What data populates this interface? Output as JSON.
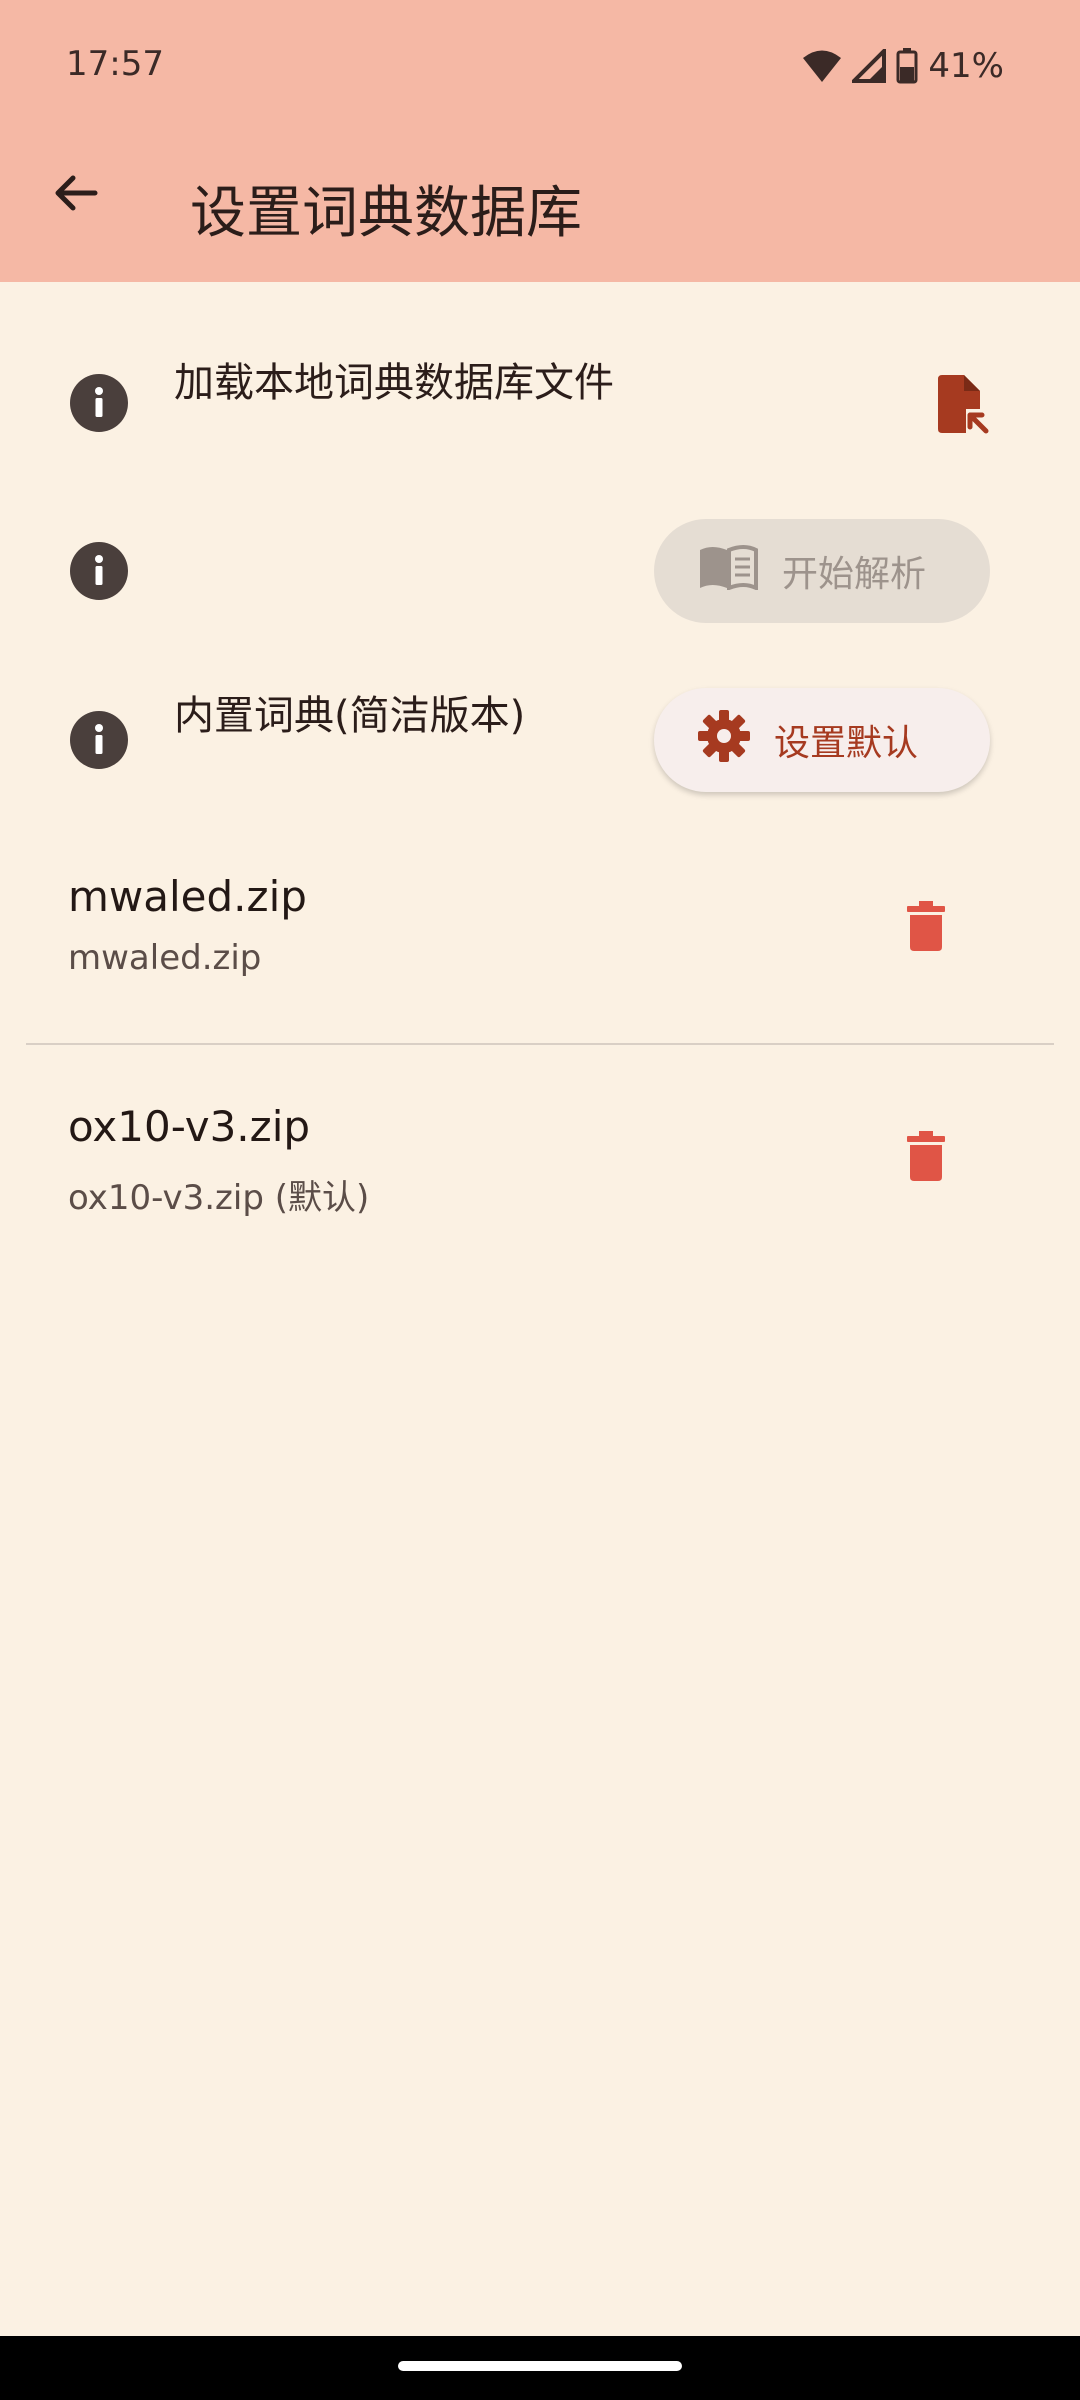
{
  "status_bar": {
    "time": "17:57",
    "battery_percent": "41%",
    "icons": [
      "wifi-icon",
      "cell-signal-icon",
      "battery-icon"
    ]
  },
  "app_bar": {
    "title": "设置词典数据库",
    "back_icon": "arrow-back-icon"
  },
  "settings_rows": [
    {
      "info_icon": "info-icon",
      "label": "加载本地词典数据库文件",
      "action_icon": "file-open-icon"
    },
    {
      "info_icon": "info-icon",
      "label": "",
      "action_label": "开始解析",
      "action_icon": "book-icon",
      "action_enabled": false
    },
    {
      "info_icon": "info-icon",
      "label": "内置词典(简洁版本)",
      "action_label": "设置默认",
      "action_icon": "gear-icon",
      "action_enabled": true
    }
  ],
  "dictionaries": [
    {
      "name": "mwaled.zip",
      "subtitle": "mwaled.zip",
      "action_icon": "trash-icon"
    },
    {
      "name": "ox10-v3.zip",
      "subtitle": "ox10-v3.zip (默认)",
      "action_icon": "trash-icon"
    }
  ],
  "colors": {
    "app_bar": "#F5B8A5",
    "background": "#FBF1E3",
    "accent": "#A63A20",
    "delete": "#E05546",
    "info_icon": "#4A3F3C"
  }
}
